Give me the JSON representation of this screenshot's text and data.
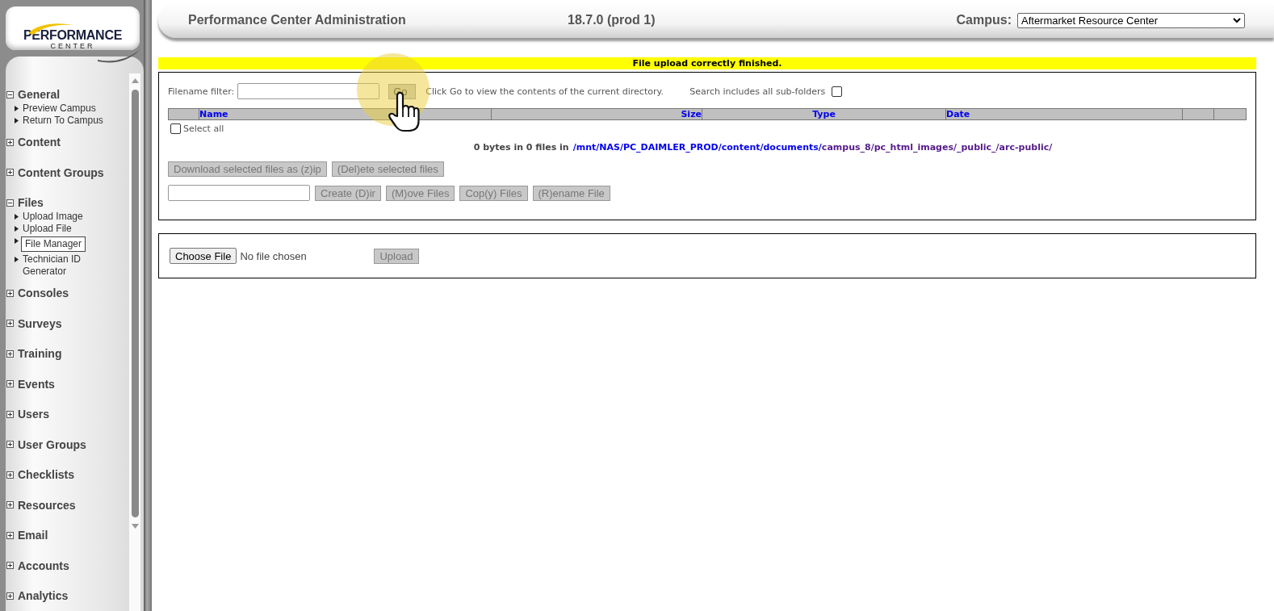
{
  "logo": {
    "line_1": "PERFORMANCE",
    "line_2": "CENTER"
  },
  "sidebar": {
    "sections": [
      {
        "label": "General",
        "expanded": true,
        "items": [
          {
            "label": "Preview Campus",
            "selected": false
          },
          {
            "label": "Return To Campus",
            "selected": false
          }
        ]
      },
      {
        "label": "Content",
        "expanded": false
      },
      {
        "label": "Content Groups",
        "expanded": false
      },
      {
        "label": "Files",
        "expanded": true,
        "items": [
          {
            "label": "Upload Image",
            "selected": false
          },
          {
            "label": "Upload File",
            "selected": false
          },
          {
            "label": "File Manager",
            "selected": true
          },
          {
            "label": "Technician ID Generator",
            "selected": false
          }
        ]
      },
      {
        "label": "Consoles",
        "expanded": false
      },
      {
        "label": "Surveys",
        "expanded": false
      },
      {
        "label": "Training",
        "expanded": false
      },
      {
        "label": "Events",
        "expanded": false
      },
      {
        "label": "Users",
        "expanded": false
      },
      {
        "label": "User Groups",
        "expanded": false
      },
      {
        "label": "Checklists",
        "expanded": false
      },
      {
        "label": "Resources",
        "expanded": false
      },
      {
        "label": "Email",
        "expanded": false
      },
      {
        "label": "Accounts",
        "expanded": false
      },
      {
        "label": "Analytics",
        "expanded": false
      }
    ]
  },
  "header": {
    "title": "Performance Center Administration",
    "version": "18.7.0 (prod 1)",
    "campus_label": "Campus:",
    "campus_value": "Aftermarket Resource Center"
  },
  "message": "File upload correctly finished.",
  "file_manager": {
    "filter_label": "Filename filter:",
    "go_button": "Go",
    "hint": "Click Go to view the contents of the current directory.",
    "subfolders_label": "Search includes all sub-folders",
    "subfolders_checked": false,
    "columns": [
      "Name",
      "Size",
      "Type",
      "Date"
    ],
    "select_all": {
      "label": "Select all",
      "checked": false
    },
    "summary": "0 bytes in 0 files in",
    "path": [
      {
        "text": "/mnt/NAS/PC_DAIMLER_PROD/content/documents/",
        "visited": false
      },
      {
        "text": "campus_8/pc_html_images/_public_/arc-public/",
        "visited": true
      }
    ],
    "actions_row_1": [
      {
        "label": "Download selected files as (z)ip",
        "disabled": true
      },
      {
        "label": "(Del)ete selected files",
        "disabled": true
      }
    ],
    "actions_row_2": [
      {
        "label": "Create (D)ir",
        "disabled": true
      },
      {
        "label": "(M)ove Files",
        "disabled": true
      },
      {
        "label": "Cop(y) Files",
        "disabled": true
      },
      {
        "label": "(R)ename File",
        "disabled": true
      }
    ]
  },
  "upload": {
    "choose_button": "Choose File",
    "file_status": "No file chosen",
    "upload_button": {
      "label": "Upload",
      "disabled": true
    }
  }
}
